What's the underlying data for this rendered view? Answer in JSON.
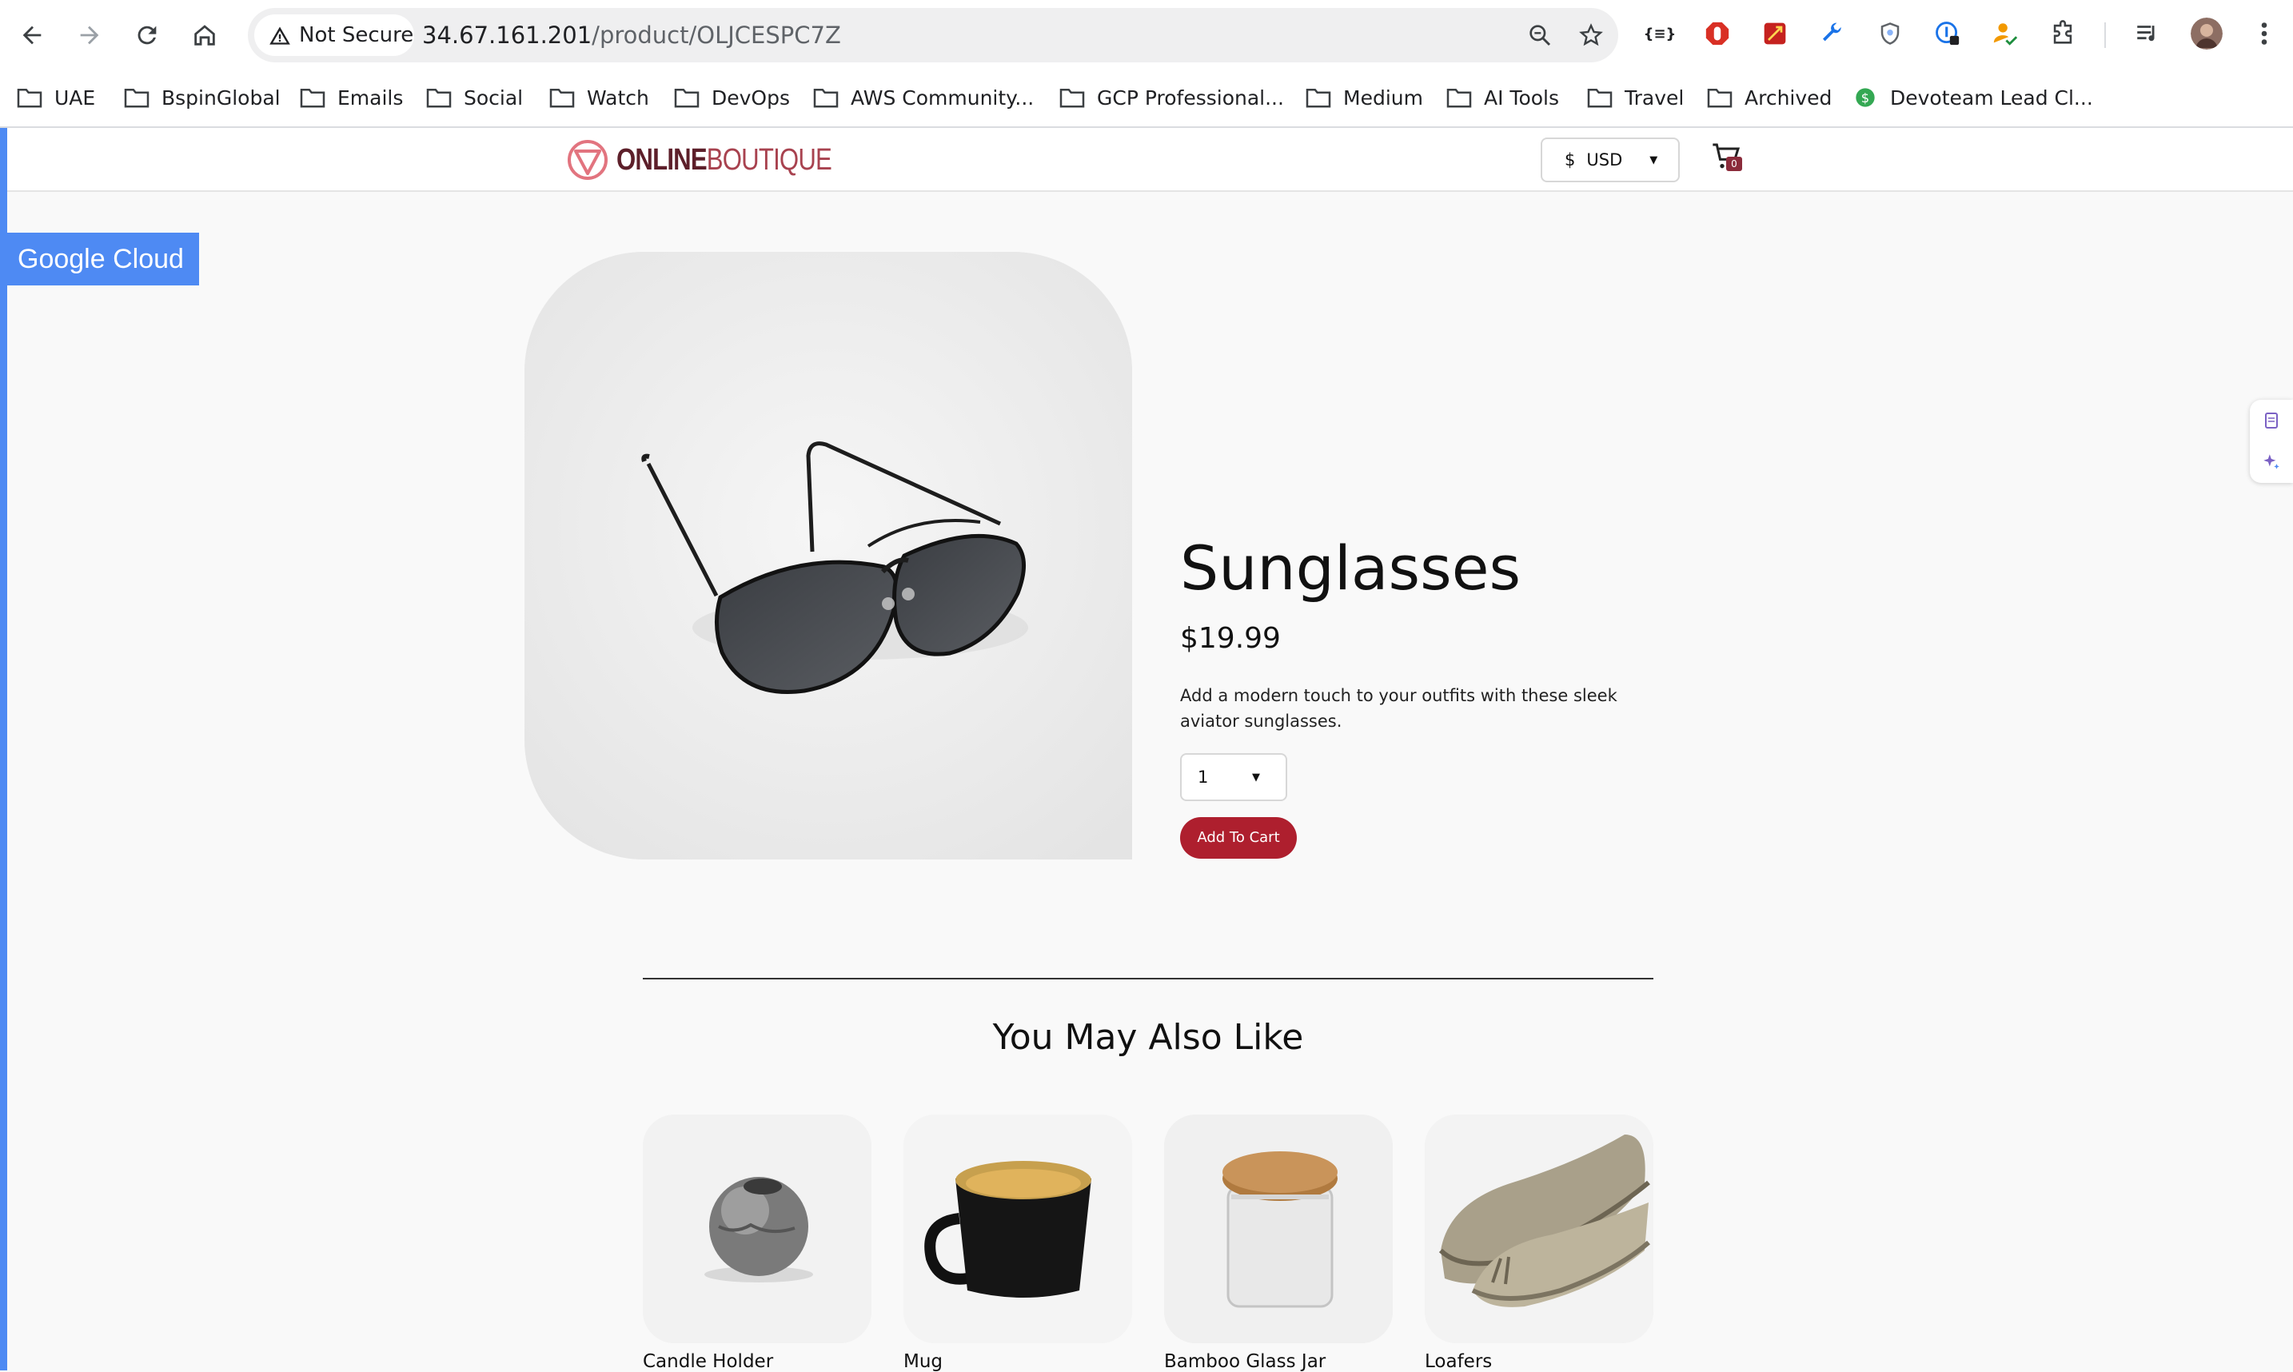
{
  "browser": {
    "security_label": "Not Secure",
    "url_host": "34.67.161.201",
    "url_path": "/product/OLJCESPC7Z",
    "bookmarks": [
      {
        "label": "UAE",
        "icon": "folder-icon"
      },
      {
        "label": "BspinGlobal",
        "icon": "folder-icon"
      },
      {
        "label": "Emails",
        "icon": "folder-icon"
      },
      {
        "label": "Social",
        "icon": "folder-icon"
      },
      {
        "label": "Watch",
        "icon": "folder-icon"
      },
      {
        "label": "DevOps",
        "icon": "folder-icon"
      },
      {
        "label": "AWS Community...",
        "icon": "folder-icon"
      },
      {
        "label": "GCP Professional...",
        "icon": "folder-icon"
      },
      {
        "label": "Medium",
        "icon": "folder-icon"
      },
      {
        "label": "AI Tools",
        "icon": "folder-icon"
      },
      {
        "label": "Travel",
        "icon": "folder-icon"
      },
      {
        "label": "Archived",
        "icon": "folder-icon"
      },
      {
        "label": "Devoteam Lead Cl...",
        "icon": "dollar-site-icon"
      }
    ],
    "extensions_label": "{≡}"
  },
  "overlay": {
    "badge": "Google Cloud"
  },
  "header": {
    "logo_bold": "ONLINE",
    "logo_light": "BOUTIQUE",
    "currency_symbol": "$",
    "currency_code": "USD",
    "cart_count": "0"
  },
  "product": {
    "title": "Sunglasses",
    "price": "$19.99",
    "description": "Add a modern touch to your outfits with these sleek aviator sunglasses.",
    "quantity": "1",
    "add_to_cart": "Add To Cart"
  },
  "recommendations": {
    "heading": "You May Also Like",
    "items": [
      {
        "name": "Candle Holder"
      },
      {
        "name": "Mug"
      },
      {
        "name": "Bamboo Glass Jar"
      },
      {
        "name": "Loafers"
      }
    ]
  },
  "colors": {
    "accent_red": "#ae1f2e",
    "google_cloud_blue": "#4e8af3",
    "logo_maroon": "#5d1f2a"
  }
}
